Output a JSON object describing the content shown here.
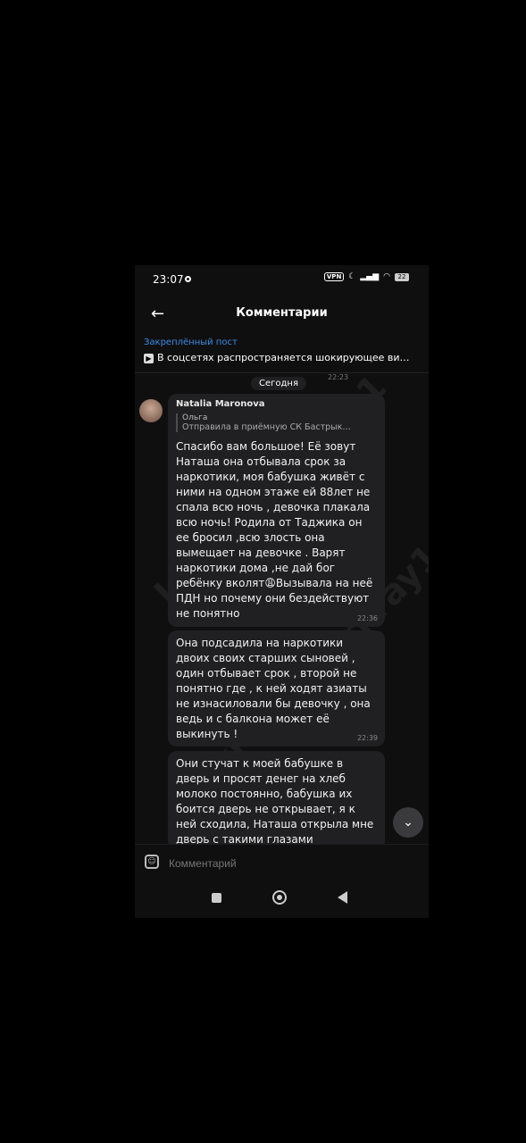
{
  "status": {
    "time": "23:07",
    "vpn": "VPN",
    "battery": "22"
  },
  "header": {
    "back_icon": "arrow-left-icon",
    "title": "Комментарии"
  },
  "pinned": {
    "label": "Закреплённый пост",
    "text": "В соцсетях распространяется шокирующее ви…"
  },
  "day_separator": "Сегодня",
  "prev_time": "22:23",
  "comment": {
    "author": "Natalia Maronova",
    "quote_author": "Ольга",
    "quote_text": "Отправила в приёмную СК Бастрык…",
    "messages": [
      {
        "text": "Спасибо вам большое! Её зовут Наташа она отбывала срок за наркотики, моя бабушка живёт с ними на одном этаже ей 88лет не спала всю ночь , девочка плакала всю ночь! Родила от Таджика он ее бросил ,всю злость она вымещает на девочке . Варят наркотики дома ,не дай бог ребёнку вколят😩Вызывала на неё ПДН но почему они бездействуют не понятно",
        "time": "22:36"
      },
      {
        "text": "Она подсадила на наркотики двоих своих старших сыновей , один отбывает срок , второй не понятно где , к ней ходят азиаты не изнасиловали  бы девочку , она ведь и с балкона может её выкинуть  !",
        "time": "22:39"
      },
      {
        "text": "Они стучат к моей бабушке в дверь и просят денег на хлеб молоко постоянно, бабушка их боится дверь не открывает,  я к ней сходила, Наташа открыла мне дверь с такими глазами",
        "time": ""
      }
    ]
  },
  "composer": {
    "placeholder": "Комментарий"
  },
  "watermark": "krasnodarkray1"
}
